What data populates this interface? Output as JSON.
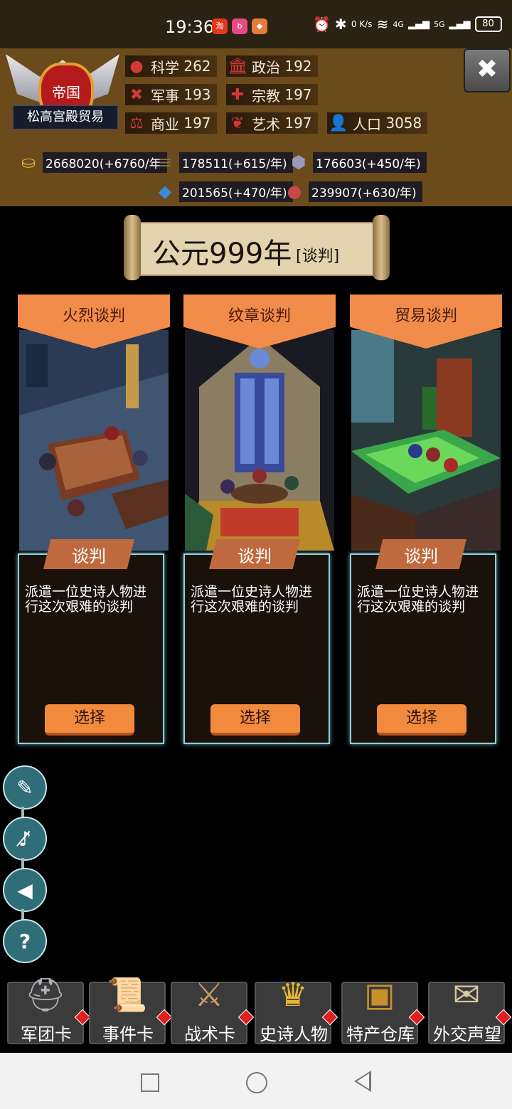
{
  "status_bar": {
    "time": "19:36",
    "net_speed": "0 K/s",
    "signal_1": "4G",
    "signal_2": "5G",
    "battery": "80"
  },
  "empire": {
    "emblem_label": "帝国",
    "name": "松高宫殿贸易"
  },
  "stats": [
    {
      "label": "科学",
      "value": "262",
      "icon": "planet-icon"
    },
    {
      "label": "政治",
      "value": "192",
      "icon": "temple-icon"
    },
    {
      "label": "军事",
      "value": "193",
      "icon": "crossed-swords-icon"
    },
    {
      "label": "宗教",
      "value": "197",
      "icon": "cross-icon"
    },
    {
      "label": "商业",
      "value": "197",
      "icon": "scales-icon"
    },
    {
      "label": "艺术",
      "value": "197",
      "icon": "lotus-icon"
    },
    {
      "label": "人口",
      "value": "3058",
      "icon": "person-icon"
    }
  ],
  "resources": [
    {
      "text": "2668020(+6760/年",
      "icon": "gold-coins-icon"
    },
    {
      "text": "178511(+615/年)",
      "icon": "wood-logs-icon"
    },
    {
      "text": "176603(+450/年)",
      "icon": "stone-icon"
    },
    {
      "text": "201565(+470/年)",
      "icon": "iron-ore-icon"
    },
    {
      "text": "239907(+630/年)",
      "icon": "meat-icon"
    }
  ],
  "year_banner": {
    "year": "公元999年",
    "tag": "[谈判]"
  },
  "cards": [
    {
      "title": "火烈谈判",
      "tag": "谈判",
      "description": "派遣一位史诗人物进行这次艰难的谈判",
      "button": "选择"
    },
    {
      "title": "纹章谈判",
      "tag": "谈判",
      "description": "派遣一位史诗人物进行这次艰难的谈判",
      "button": "选择"
    },
    {
      "title": "贸易谈判",
      "tag": "谈判",
      "description": "派遣一位史诗人物进行这次艰难的谈判",
      "button": "选择"
    }
  ],
  "side_buttons": [
    "book-quill-icon",
    "music-off-icon",
    "speaker-icon",
    "help-icon"
  ],
  "help_symbol": "?",
  "close_symbol": "✖",
  "bottom_nav": [
    {
      "label": "军团卡",
      "icon": "helmet-icon"
    },
    {
      "label": "事件卡",
      "icon": "scroll-icon"
    },
    {
      "label": "战术卡",
      "icon": "shield-swords-icon"
    },
    {
      "label": "史诗人物",
      "icon": "crown-icon"
    },
    {
      "label": "特产仓库",
      "icon": "treasure-chest-icon"
    },
    {
      "label": "外交声望",
      "icon": "envelope-icon"
    }
  ],
  "colors": {
    "header_bg": "#6b4a1b",
    "card_banner": "#f18c4a",
    "button": "#f28a3e",
    "card_border": "#8fd3de",
    "side_button": "#2f6e78"
  }
}
